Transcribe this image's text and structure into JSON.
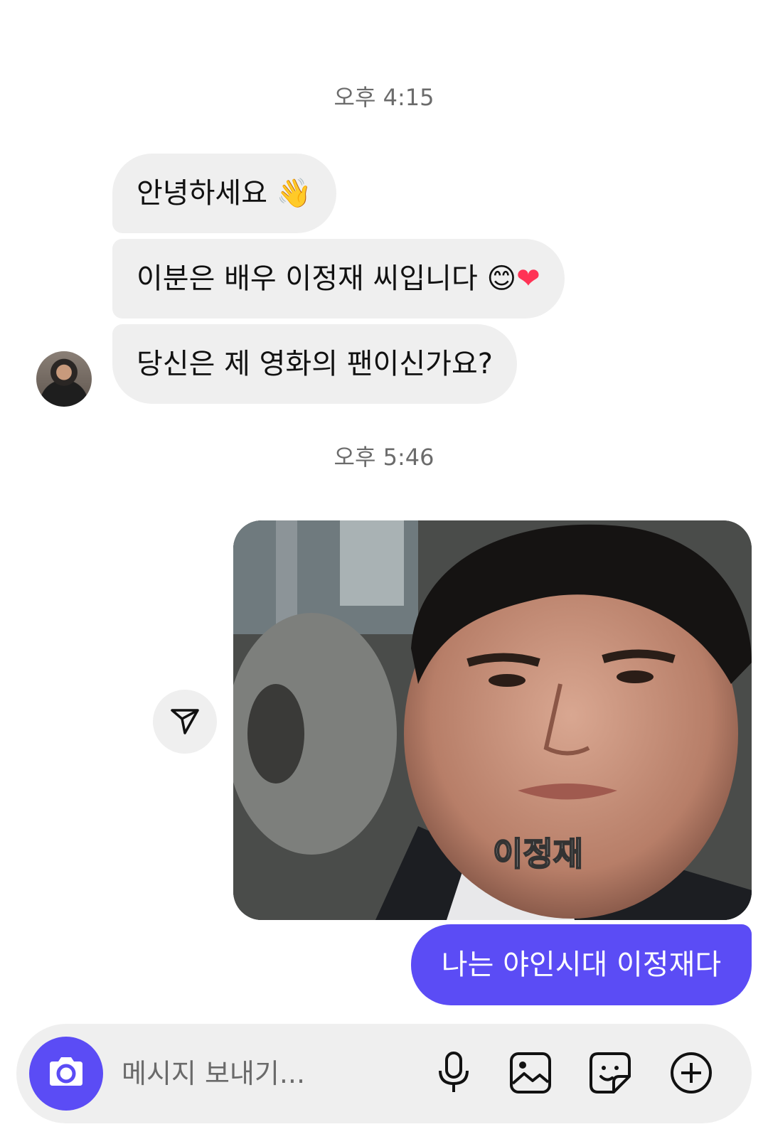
{
  "timestamps": [
    "오후 4:15",
    "오후 5:46"
  ],
  "incoming": [
    {
      "text": "안녕하세요",
      "emoji": "👋"
    },
    {
      "text": "이분은 배우 이정재 씨입니다",
      "emoji": "😊",
      "emoji2": "❤"
    },
    {
      "text": "당신은 제 영화의 팬이신가요?"
    }
  ],
  "outgoing": {
    "image_caption": "이정재",
    "text": "나는 야인시대 이정재다"
  },
  "composer": {
    "placeholder": "메시지 보내기..."
  },
  "colors": {
    "accent": "#5b4cf5",
    "bubble_in": "#efefef",
    "timestamp": "#6b6b6b"
  },
  "icons": [
    "camera-icon",
    "microphone-icon",
    "gallery-icon",
    "sticker-icon",
    "plus-circle-icon",
    "share-arrow-icon"
  ]
}
